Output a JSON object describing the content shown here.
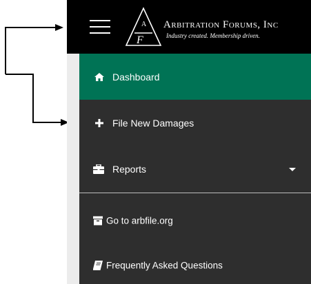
{
  "brand": {
    "name": "Arbitration Forums, Inc",
    "tagline": "Industry created. Membership driven.",
    "logo_letters": "AF"
  },
  "header": {
    "menu_icon": "hamburger-menu-icon"
  },
  "sidebar": {
    "items": [
      {
        "label": "Dashboard",
        "icon": "home-icon",
        "active": true
      },
      {
        "label": "File New Damages",
        "icon": "plus-icon"
      },
      {
        "label": "Reports",
        "icon": "briefcase-icon",
        "has_dropdown": true
      }
    ],
    "links": [
      {
        "label": "Go to arbfile.org",
        "icon": "archive-icon"
      },
      {
        "label": "Frequently Asked Questions",
        "icon": "book-icon"
      }
    ]
  },
  "colors": {
    "active_bg": "#007355",
    "sidebar_bg": "#2e2e2e",
    "topbar_bg": "#000000"
  }
}
